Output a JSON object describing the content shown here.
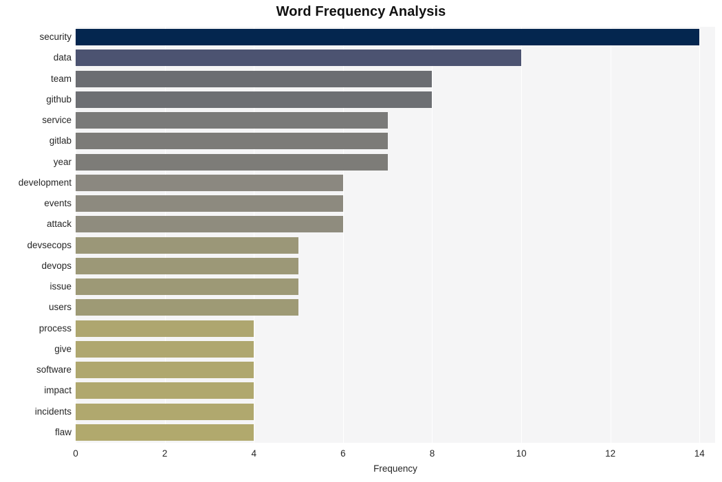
{
  "chart_data": {
    "type": "bar",
    "orientation": "horizontal",
    "title": "Word Frequency Analysis",
    "xlabel": "Frequency",
    "ylabel": "",
    "xlim": [
      0,
      14.35
    ],
    "ylim": null,
    "grid": "vertical-only",
    "legend": "none",
    "xticks": [
      0,
      2,
      4,
      6,
      8,
      10,
      12,
      14
    ],
    "xticklabels": [
      "0",
      "2",
      "4",
      "6",
      "8",
      "10",
      "12",
      "14"
    ],
    "categories": [
      "security",
      "data",
      "team",
      "github",
      "service",
      "gitlab",
      "year",
      "development",
      "events",
      "attack",
      "devsecops",
      "devops",
      "issue",
      "users",
      "process",
      "give",
      "software",
      "impact",
      "incidents",
      "flaw"
    ],
    "values": [
      14,
      10,
      8,
      8,
      7,
      7,
      7,
      6,
      6,
      6,
      5,
      5,
      5,
      5,
      4,
      4,
      4,
      4,
      4,
      4
    ],
    "bar_colors": [
      "#04264f",
      "#4c5371",
      "#6b6d72",
      "#6d6f73",
      "#7a7a79",
      "#7c7b78",
      "#7d7c78",
      "#8b8880",
      "#8d8a7f",
      "#8f8c7e",
      "#9b9778",
      "#9c9877",
      "#9d9976",
      "#9e9a75",
      "#aea66f",
      "#afa76f",
      "#afa76e",
      "#b0a86e",
      "#b0a86e",
      "#b1a96d"
    ],
    "plot_background": "#f5f5f6",
    "figure_background": "#ffffff",
    "gridline_color": "#ffffff",
    "text_color": "#262626"
  }
}
